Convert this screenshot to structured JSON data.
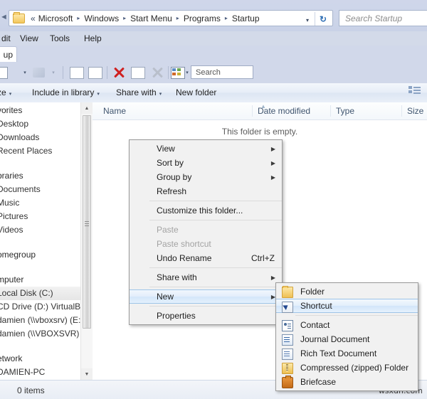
{
  "address": {
    "back_chevrons": "«",
    "breadcrumbs": [
      "Microsoft",
      "Windows",
      "Start Menu",
      "Programs",
      "Startup"
    ],
    "separator": "▸",
    "dropdown_caret": "▾",
    "refresh_glyph": "↻"
  },
  "search": {
    "placeholder": "Search Startup"
  },
  "menubar": {
    "items": [
      "dit",
      "View",
      "Tools",
      "Help"
    ]
  },
  "tab": {
    "label": "up"
  },
  "toolbar2": {
    "search_label": "Search",
    "caret": "▾"
  },
  "commandbar": {
    "items": [
      {
        "label": "ze",
        "caret": "▾"
      },
      {
        "label": "Include in library",
        "caret": "▾"
      },
      {
        "label": "Share with",
        "caret": "▾"
      },
      {
        "label": "New folder",
        "caret": ""
      }
    ]
  },
  "navpane": {
    "items": [
      {
        "label": "vorites",
        "type": "header",
        "selected": false
      },
      {
        "label": "Desktop",
        "type": "item",
        "selected": false
      },
      {
        "label": "Downloads",
        "type": "item",
        "selected": false
      },
      {
        "label": "Recent Places",
        "type": "item",
        "selected": false
      },
      {
        "label": "braries",
        "type": "header",
        "selected": false
      },
      {
        "label": "Documents",
        "type": "item",
        "selected": false
      },
      {
        "label": "Music",
        "type": "item",
        "selected": false
      },
      {
        "label": "Pictures",
        "type": "item",
        "selected": false
      },
      {
        "label": "Videos",
        "type": "item",
        "selected": false
      },
      {
        "label": "omegroup",
        "type": "header",
        "selected": false
      },
      {
        "label": "mputer",
        "type": "header",
        "selected": false
      },
      {
        "label": "Local Disk (C:)",
        "type": "item",
        "selected": true
      },
      {
        "label": "CD Drive (D:) VirtualBox G",
        "type": "item",
        "selected": false
      },
      {
        "label": "damien (\\\\vboxsrv) (E:)",
        "type": "item",
        "selected": false
      },
      {
        "label": "damien (\\\\VBOXSVR) (Z:)",
        "type": "item",
        "selected": false
      },
      {
        "label": "etwork",
        "type": "header",
        "selected": false
      },
      {
        "label": "DAMIEN-PC",
        "type": "item",
        "selected": false
      }
    ],
    "scroll_up": "▲",
    "scroll_down": "▼"
  },
  "list": {
    "columns": [
      "Name",
      "Date modified",
      "Type",
      "Size"
    ],
    "sort_indicator": "▲",
    "empty_message": "This folder is empty."
  },
  "statusbar": {
    "text": "0 items",
    "watermark": "wsxdn.com"
  },
  "context_menu": {
    "arrow": "▶",
    "items": [
      {
        "label": "View",
        "submenu": true,
        "disabled": false,
        "highlight": false,
        "accel": ""
      },
      {
        "label": "Sort by",
        "submenu": true,
        "disabled": false,
        "highlight": false,
        "accel": ""
      },
      {
        "label": "Group by",
        "submenu": true,
        "disabled": false,
        "highlight": false,
        "accel": ""
      },
      {
        "label": "Refresh",
        "submenu": false,
        "disabled": false,
        "highlight": false,
        "accel": ""
      },
      {
        "separator": true
      },
      {
        "label": "Customize this folder...",
        "submenu": false,
        "disabled": false,
        "highlight": false,
        "accel": ""
      },
      {
        "separator": true
      },
      {
        "label": "Paste",
        "submenu": false,
        "disabled": true,
        "highlight": false,
        "accel": ""
      },
      {
        "label": "Paste shortcut",
        "submenu": false,
        "disabled": true,
        "highlight": false,
        "accel": ""
      },
      {
        "label": "Undo Rename",
        "submenu": false,
        "disabled": false,
        "highlight": false,
        "accel": "Ctrl+Z"
      },
      {
        "separator": true
      },
      {
        "label": "Share with",
        "submenu": true,
        "disabled": false,
        "highlight": false,
        "accel": ""
      },
      {
        "separator": true
      },
      {
        "label": "New",
        "submenu": true,
        "disabled": false,
        "highlight": true,
        "accel": ""
      },
      {
        "separator": true
      },
      {
        "label": "Properties",
        "submenu": false,
        "disabled": false,
        "highlight": false,
        "accel": ""
      }
    ]
  },
  "new_submenu": {
    "items": [
      {
        "label": "Folder",
        "icon": "folder-icon",
        "highlight": false
      },
      {
        "label": "Shortcut",
        "icon": "shortcut-icon",
        "highlight": true
      },
      {
        "separator": true
      },
      {
        "label": "Contact",
        "icon": "contact-icon",
        "highlight": false
      },
      {
        "label": "Journal Document",
        "icon": "journal-icon",
        "highlight": false
      },
      {
        "label": "Rich Text Document",
        "icon": "rich-text-icon",
        "highlight": false
      },
      {
        "label": "Compressed (zipped) Folder",
        "icon": "zip-folder-icon",
        "highlight": false
      },
      {
        "label": "Briefcase",
        "icon": "briefcase-icon",
        "highlight": false
      }
    ]
  },
  "colors": {
    "chrome_blue": "#cfd6ea",
    "highlight_blue": "#d3e6fa",
    "delete_red": "#cf2020",
    "folder_yellow": "#efc054"
  }
}
